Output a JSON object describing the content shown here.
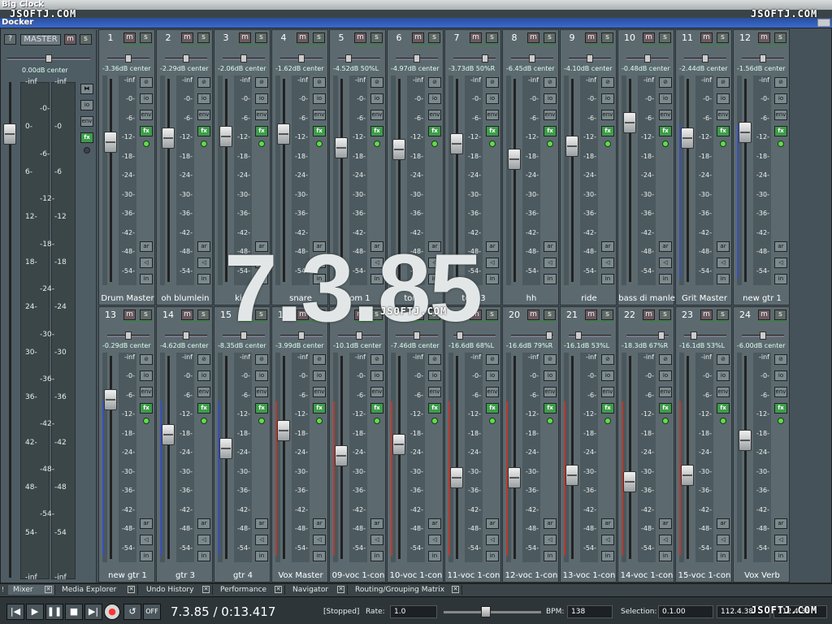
{
  "windows": {
    "bigclock_title": "Big Clock",
    "docker_title": "Docker"
  },
  "watermark": {
    "left": "JSOFTJ.COM",
    "right": "JSOFTJ.COM",
    "center": "JSOFTJ.COM",
    "bottom": "JSOFTJ.COM"
  },
  "big_clock": "7.3.85",
  "master": {
    "help_label": "?",
    "label": "MASTER",
    "mute_label": "m",
    "solo_label": "s",
    "readout": "0.00dB center",
    "scale_left": [
      "-inf",
      "0-",
      "6-",
      "12-",
      "18-",
      "24-",
      "30-",
      "36-",
      "42-",
      "48-",
      "54-",
      "-inf"
    ],
    "scale_inner": [
      "-0-",
      "-6-",
      "-12-",
      "-18-",
      "-24-",
      "-30-",
      "-36-",
      "-42-",
      "-48-",
      "-54-"
    ],
    "scale_right": [
      "-inf",
      "-0",
      "-6",
      "-12",
      "-18",
      "-24",
      "-30",
      "-36",
      "-42",
      "-48",
      "-54",
      "-inf"
    ],
    "buttons": [
      "io",
      "env",
      "fx"
    ],
    "fader_db": -0.5
  },
  "strip_scale": [
    "-inf",
    "-0-",
    "-6-",
    "-12-",
    "-18-",
    "-24-",
    "-30-",
    "-36-",
    "-42-",
    "-48-",
    "-54-"
  ],
  "strip_buttons": {
    "phase": "⊘",
    "io": "io",
    "env": "env",
    "fx": "fx",
    "ar": "ar",
    "mon": "◁",
    "in": "in",
    "mute": "m",
    "solo": "s"
  },
  "channels": [
    {
      "num": "1",
      "name": "Drum Master",
      "readout": "-3.36dB center",
      "fader": 0.27,
      "pan": 0.5,
      "meter": ""
    },
    {
      "num": "2",
      "name": "oh blumlein",
      "readout": "-2.29dB center",
      "fader": 0.25,
      "pan": 0.5,
      "meter": ""
    },
    {
      "num": "3",
      "name": "kick",
      "readout": "-2.06dB center",
      "fader": 0.24,
      "pan": 0.5,
      "meter": ""
    },
    {
      "num": "4",
      "name": "snare",
      "readout": "-1.62dB center",
      "fader": 0.23,
      "pan": 0.5,
      "meter": ""
    },
    {
      "num": "5",
      "name": "tom 1",
      "readout": "-4.52dB 50%L",
      "fader": 0.3,
      "pan": 0.25,
      "meter": ""
    },
    {
      "num": "6",
      "name": "tom 2",
      "readout": "-4.97dB center",
      "fader": 0.31,
      "pan": 0.5,
      "meter": ""
    },
    {
      "num": "7",
      "name": "tom 3",
      "readout": "-3.73dB 50%R",
      "fader": 0.28,
      "pan": 0.75,
      "meter": ""
    },
    {
      "num": "8",
      "name": "hh",
      "readout": "-6.45dB center",
      "fader": 0.36,
      "pan": 0.5,
      "meter": ""
    },
    {
      "num": "9",
      "name": "ride",
      "readout": "-4.10dB center",
      "fader": 0.29,
      "pan": 0.5,
      "meter": ""
    },
    {
      "num": "10",
      "name": "bass di manle",
      "readout": "-0.48dB center",
      "fader": 0.17,
      "pan": 0.5,
      "meter": ""
    },
    {
      "num": "11",
      "name": "Grit Master",
      "readout": "-2.44dB center",
      "fader": 0.25,
      "pan": 0.5,
      "meter": "blue"
    },
    {
      "num": "12",
      "name": "new gtr 1",
      "readout": "-1.56dB center",
      "fader": 0.22,
      "pan": 0.5,
      "meter": "blue"
    },
    {
      "num": "13",
      "name": "new gtr 1",
      "readout": "-0.29dB center",
      "fader": 0.17,
      "pan": 0.5,
      "meter": "blue"
    },
    {
      "num": "14",
      "name": "gtr 3",
      "readout": "-4.62dB center",
      "fader": 0.35,
      "pan": 0.5,
      "meter": "blue"
    },
    {
      "num": "15",
      "name": "gtr 4",
      "readout": "-8.35dB center",
      "fader": 0.42,
      "pan": 0.5,
      "meter": "blue"
    },
    {
      "num": "16",
      "name": "Vox Master",
      "readout": "-3.99dB center",
      "fader": 0.33,
      "pan": 0.5,
      "meter": "red"
    },
    {
      "num": "17",
      "name": "09-voc 1-con",
      "readout": "-10.1dB center",
      "fader": 0.46,
      "pan": 0.5,
      "meter": "red"
    },
    {
      "num": "18",
      "name": "10-voc 1-con",
      "readout": "-7.46dB center",
      "fader": 0.4,
      "pan": 0.5,
      "meter": "red"
    },
    {
      "num": "19",
      "name": "11-voc 1-con",
      "readout": "-16.6dB 68%L",
      "fader": 0.57,
      "pan": 0.16,
      "meter": "red"
    },
    {
      "num": "20",
      "name": "12-voc 1-con",
      "readout": "-16.6dB 79%R",
      "fader": 0.57,
      "pan": 0.9,
      "meter": "red"
    },
    {
      "num": "21",
      "name": "13-voc 1-con",
      "readout": "-16.1dB 53%L",
      "fader": 0.56,
      "pan": 0.24,
      "meter": "red"
    },
    {
      "num": "22",
      "name": "14-voc 1-con",
      "readout": "-18.3dB 67%R",
      "fader": 0.59,
      "pan": 0.83,
      "meter": "red"
    },
    {
      "num": "23",
      "name": "15-voc 1-con",
      "readout": "-16.1dB 53%L",
      "fader": 0.56,
      "pan": 0.24,
      "meter": "red"
    },
    {
      "num": "24",
      "name": "Vox Verb",
      "readout": "-6.00dB center",
      "fader": 0.38,
      "pan": 0.5,
      "meter": ""
    }
  ],
  "tabs": [
    {
      "label": "Mixer",
      "active": true
    },
    {
      "label": "Media Explorer",
      "active": false
    },
    {
      "label": "Undo History",
      "active": false
    },
    {
      "label": "Performance",
      "active": false
    },
    {
      "label": "Navigator",
      "active": false
    },
    {
      "label": "Routing/Grouping Matrix",
      "active": false
    }
  ],
  "transport": {
    "buttons": [
      "|◀",
      "▶",
      "❚❚",
      "■",
      "▶|",
      "●",
      "↺",
      "OFF"
    ],
    "position": "7.3.85 / 0:13.417",
    "status": "[Stopped]",
    "rate_label": "Rate:",
    "rate_value": "1.0",
    "bpm_label": "BPM:",
    "bpm_value": "138",
    "selection_label": "Selection:",
    "selection_start": "0.1.00",
    "selection_end": "112.4.38",
    "selection_len": "112.4.38"
  },
  "colors": {
    "meter_blue": "#3a4fb8",
    "meter_red": "#b83a2e",
    "fx_green": "#3e9c4a",
    "led_green": "#5fdd4a"
  }
}
